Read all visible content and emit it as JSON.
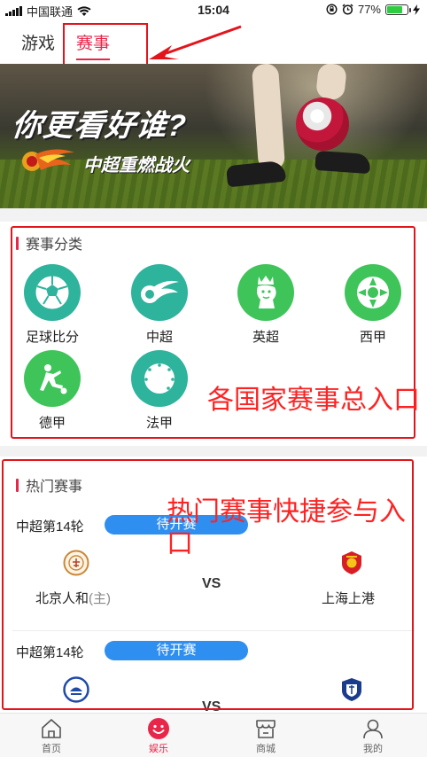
{
  "status_bar": {
    "carrier": "中国联通",
    "time": "15:04",
    "battery_percent": "77%",
    "battery_level": 0.77,
    "icons": [
      "signal-icon",
      "wifi-icon",
      "rotation-lock-icon",
      "alarm-icon",
      "battery-icon",
      "charging-icon"
    ]
  },
  "tabs": [
    {
      "label": "游戏",
      "active": false
    },
    {
      "label": "赛事",
      "active": true
    }
  ],
  "banner": {
    "headline": "你更看好谁?",
    "subline": "中超重燃战火"
  },
  "categories": {
    "title": "赛事分类",
    "items": [
      {
        "label": "足球比分",
        "icon": "soccer-ball-icon",
        "color": "#2eb39c"
      },
      {
        "label": "中超",
        "icon": "csl-logo-icon",
        "color": "#2eb39c"
      },
      {
        "label": "英超",
        "icon": "premier-league-lion-icon",
        "color": "#3fc45a"
      },
      {
        "label": "西甲",
        "icon": "laliga-ball-icon",
        "color": "#3fc45a"
      },
      {
        "label": "德甲",
        "icon": "bundesliga-player-icon",
        "color": "#3fc45a"
      },
      {
        "label": "法甲",
        "icon": "ligue1-ball-icon",
        "color": "#2eb39c"
      }
    ],
    "annotation": "各国家赛事总入口"
  },
  "hot_matches": {
    "title": "热门赛事",
    "annotation": "热门赛事快捷参与入口",
    "matches": [
      {
        "round": "中超第14轮",
        "status": "待开赛",
        "home": "北京人和",
        "home_tag": "(主)",
        "away": "上海上港",
        "vs": "VS"
      },
      {
        "round": "中超第14轮",
        "status": "待开赛",
        "home": "",
        "home_tag": "",
        "away": "",
        "vs": "VS"
      }
    ]
  },
  "bottom_nav": [
    {
      "label": "首页",
      "icon": "home-icon",
      "active": false
    },
    {
      "label": "娱乐",
      "icon": "smile-icon",
      "active": true
    },
    {
      "label": "商城",
      "icon": "shop-icon",
      "active": false
    },
    {
      "label": "我的",
      "icon": "user-icon",
      "active": false
    }
  ],
  "colors": {
    "accent": "#e8264a",
    "annotation": "#ff2222",
    "pill": "#2f8ff0",
    "teal": "#2eb39c",
    "green": "#3fc45a"
  }
}
